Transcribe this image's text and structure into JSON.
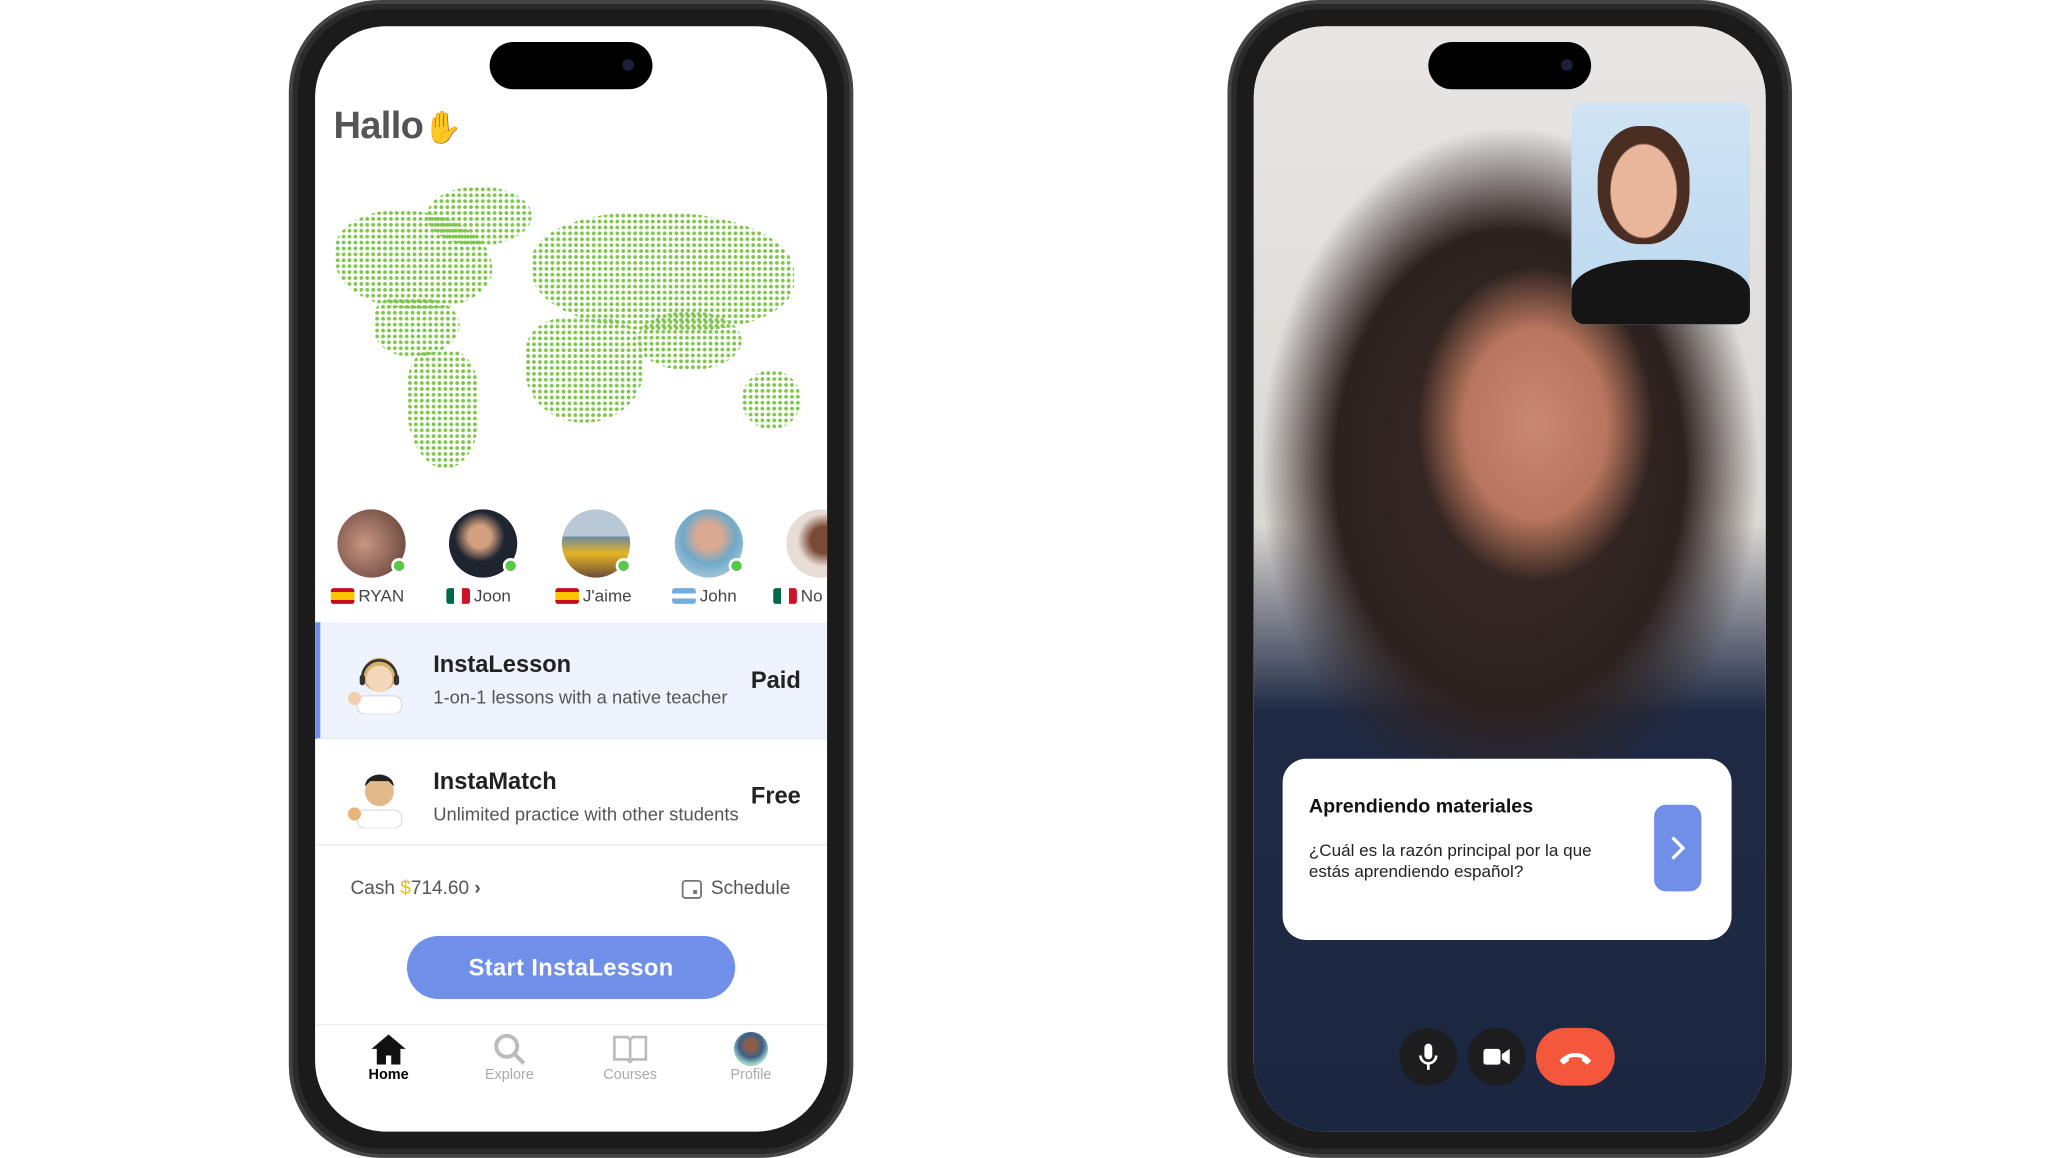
{
  "home": {
    "logo": "Hallo",
    "tutors": [
      {
        "name": "RYAN",
        "country_flag": "spain",
        "online": true
      },
      {
        "name": "Joon",
        "country_flag": "mexico",
        "online": true
      },
      {
        "name": "J'aime",
        "country_flag": "spain",
        "online": true
      },
      {
        "name": "John",
        "country_flag": "argentina",
        "online": true
      },
      {
        "name": "No",
        "country_flag": "mexico",
        "online": false
      }
    ],
    "options": [
      {
        "title": "InstaLesson",
        "subtitle": "1-on-1 lessons with a native teacher",
        "price": "Paid",
        "selected": true
      },
      {
        "title": "InstaMatch",
        "subtitle": "Unlimited practice with other students",
        "price": "Free",
        "selected": false
      }
    ],
    "cash_label": "Cash",
    "cash_currency": "$",
    "cash_amount": "714.60",
    "schedule_label": "Schedule",
    "start_button": "Start InstaLesson",
    "tabs": [
      {
        "label": "Home",
        "icon": "home-icon",
        "active": true
      },
      {
        "label": "Explore",
        "icon": "search-icon",
        "active": false
      },
      {
        "label": "Courses",
        "icon": "book-icon",
        "active": false
      },
      {
        "label": "Profile",
        "icon": "avatar",
        "active": false
      }
    ]
  },
  "call": {
    "card_title": "Aprendiendo materiales",
    "card_question": "¿Cuál es la razón principal por la que estás aprendiendo español?",
    "controls": [
      "microphone-icon",
      "video-camera-icon",
      "end-call-icon"
    ]
  },
  "colors": {
    "accent": "#6f8fe8",
    "online": "#5cc64a",
    "end_call": "#f4573b",
    "map": "#7fc64b",
    "cash": "#f4b728"
  }
}
